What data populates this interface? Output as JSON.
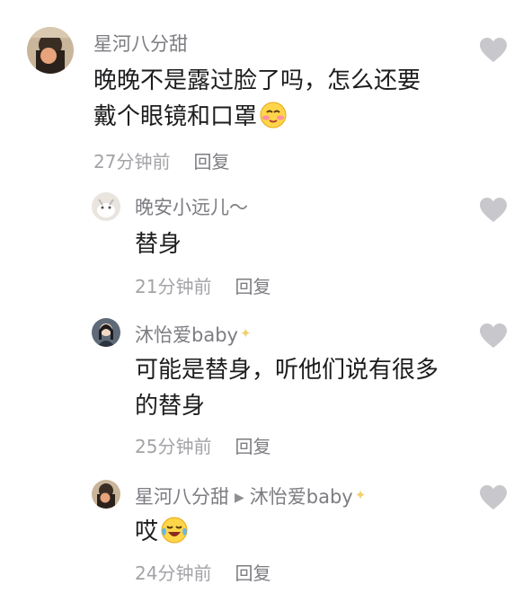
{
  "comments": [
    {
      "username": "星河八分甜",
      "lines": [
        "晚晚不是露过脸了吗，怎么还要",
        "戴个眼镜和口罩"
      ],
      "emoji": "blush-emoji",
      "time": "27分钟前",
      "reply_label": "回复"
    },
    {
      "username": "晚安小远儿～",
      "lines": [
        "替身"
      ],
      "time": "21分钟前",
      "reply_label": "回复"
    },
    {
      "username": "沐怡爱baby",
      "badge": "sparkle-icon",
      "lines": [
        "可能是替身，听他们说有很多",
        "的替身"
      ],
      "time": "25分钟前",
      "reply_label": "回复"
    },
    {
      "username": "星河八分甜",
      "reply_to": "沐怡爱baby",
      "badge": "sparkle-icon",
      "lines": [
        "哎"
      ],
      "emoji": "crying-laughing-emoji",
      "time": "24分钟前",
      "reply_label": "回复"
    }
  ],
  "colors": {
    "username": "#7c7c82",
    "content": "#1d1d1f",
    "meta": "#a3a3a8",
    "heart": "#c7c7cc"
  }
}
